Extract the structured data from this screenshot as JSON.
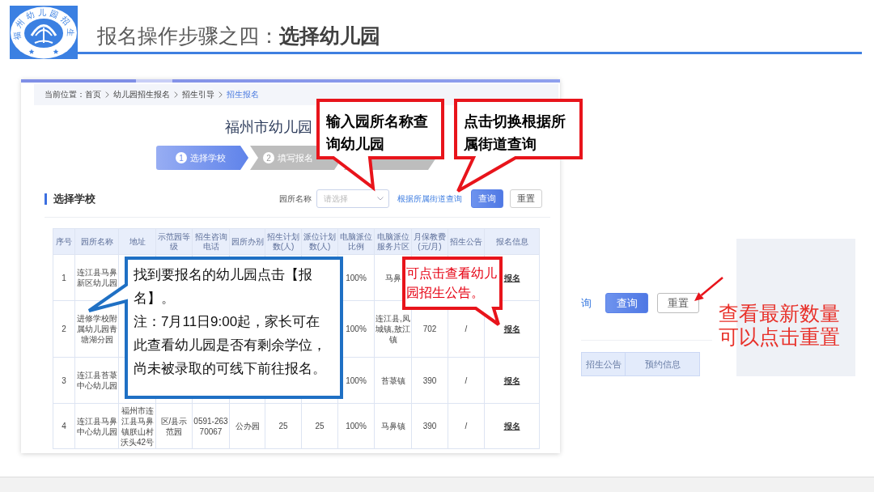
{
  "header": {
    "logo_text": "福州幼儿园招生",
    "title": "报名操作步骤之四：**选择幼儿园**"
  },
  "breadcrumb": {
    "label": "当前位置：",
    "items": [
      {
        "text": "首页",
        "current": false
      },
      {
        "text": "幼儿园招生报名",
        "current": false
      },
      {
        "text": "招生引导",
        "current": false
      },
      {
        "text": "招生报名",
        "current": true
      }
    ]
  },
  "page_title": "福州市幼儿园",
  "steps": [
    {
      "number": "1",
      "label": "选择学校",
      "selected": true
    },
    {
      "number": "2",
      "label": "填写报名",
      "selected": false
    },
    {
      "selected": false
    }
  ],
  "section": {
    "title": "选择学校",
    "filter_label": "园所名称",
    "select": {
      "placeholder": "请选择"
    },
    "street_link": "根据所属街道查询",
    "buttons": [
      {
        "label": "查询",
        "kind": "primary"
      },
      {
        "label": "重置",
        "kind": "default"
      }
    ]
  },
  "table": {
    "columns": [
      "序号",
      "园所名称",
      "地址",
      "示范园等级",
      "招生咨询电话",
      "园所办别",
      "招生计划数(人)",
      "派位计划数(人)",
      "电脑派位比例",
      "电脑派位服务片区",
      "月保教费(元/月)",
      "招生公告",
      "报名信息"
    ],
    "rows": [
      {
        "cells": [
          "1",
          "连江县马鼻新区幼儿园",
          null,
          null,
          null,
          null,
          null,
          null,
          "100%",
          "马鼻",
          null,
          null
        ],
        "signup": "报名"
      },
      {
        "cells": [
          "2",
          "进修学校附属幼儿园青塘湖分园",
          null,
          null,
          null,
          null,
          null,
          null,
          "100%",
          "连江县,凤城镇,敖江镇",
          "702",
          "/"
        ],
        "signup": "报名"
      },
      {
        "cells": [
          "3",
          "连江县苔菉中心幼儿园",
          null,
          null,
          null,
          null,
          null,
          null,
          "100%",
          "苔菉镇",
          "390",
          "/"
        ],
        "signup": "报名"
      },
      {
        "cells": [
          "4",
          "连江县马鼻中心幼儿园",
          "福州市连江县马鼻镇朕山村沃头42号",
          "区/县示范园",
          "0591-26370067",
          "公办园",
          "25",
          "25",
          "100%",
          "马鼻镇",
          "390",
          "/"
        ],
        "signup": "报名"
      }
    ]
  },
  "callouts": [
    {
      "kind": "red_bold",
      "text": "输入园所名称查询幼儿园"
    },
    {
      "kind": "red_bold",
      "text": "点击切换根据所属街道查询"
    },
    {
      "kind": "blue",
      "paragraphs": [
        "找到要报名的幼儿园点击【报名】。",
        "注：7月11日9:00起，家长可在此查看幼儿园是否有剩余学位，尚未被录取的可线下前往报名。"
      ]
    },
    {
      "kind": "red_text",
      "text": "可点击查看幼儿园招生公告。"
    }
  ],
  "inset": {
    "link_fragment": "询",
    "buttons": [
      {
        "label": "查询",
        "kind": "primary"
      },
      {
        "label": "重置",
        "kind": "default"
      }
    ],
    "columns": [
      "招生公告",
      "预约信息"
    ],
    "note": "查看最新数量可以点击重置"
  }
}
